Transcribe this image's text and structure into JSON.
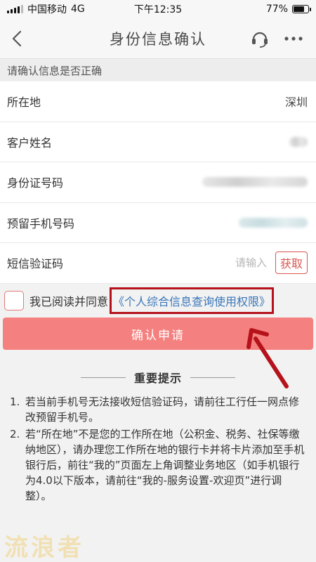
{
  "status_bar": {
    "carrier": "中国移动",
    "network": "4G",
    "time": "下午12:35",
    "battery": "77%",
    "battery_level": 0.77
  },
  "nav": {
    "title": "身份信息确认",
    "back_icon": "chevron-left-icon",
    "service_icon": "headset-icon",
    "more_icon": "more-icon"
  },
  "section_header": "请确认信息是否正确",
  "form": {
    "location": {
      "label": "所在地",
      "value": "深圳"
    },
    "name": {
      "label": "客户姓名"
    },
    "id_number": {
      "label": "身份证号码"
    },
    "phone": {
      "label": "预留手机号码"
    },
    "sms_code": {
      "label": "短信验证码",
      "placeholder": "请输入",
      "button": "获取"
    }
  },
  "agreement": {
    "text": "我已阅读并同意",
    "link": "《个人综合信息查询使用权限》"
  },
  "confirm_button": "确认申请",
  "tips": {
    "title": "重要提示",
    "items": [
      {
        "num": "1.",
        "text": "若当前手机号无法接收短信验证码，请前往工行任一网点修改预留手机号。"
      },
      {
        "num": "2.",
        "text": "若“所在地”不是您的工作所在地（公积金、税务、社保等缴纳地区），请办理您工作所在地的银行卡并将卡片添加至手机银行后，前往“我的”页面左上角调整业务地区（如手机银行为4.0以下版本，请前往“我的-服务设置-欢迎页”进行调整）。"
      }
    ]
  },
  "watermark": "流浪者",
  "colors": {
    "accent": "#f4817f",
    "link": "#3a76b8",
    "highlight_border": "#b5121b",
    "get_button": "#d9564f"
  }
}
